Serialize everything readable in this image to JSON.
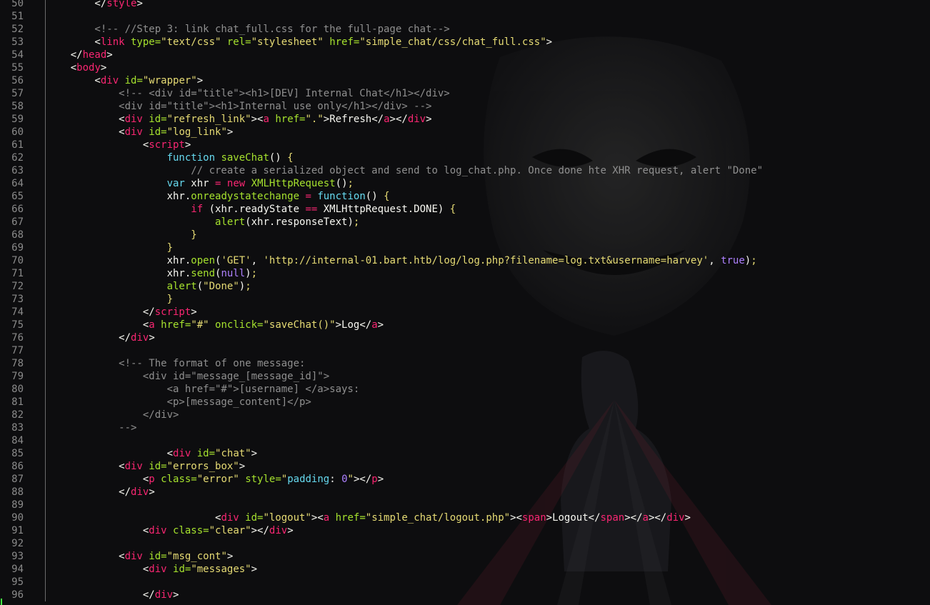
{
  "editor": {
    "lines": [
      {
        "n": "50",
        "tokens": [
          {
            "t": "        </",
            "c": "w"
          },
          {
            "t": "style",
            "c": "r"
          },
          {
            "t": ">",
            "c": "w"
          }
        ]
      },
      {
        "n": "51",
        "tokens": []
      },
      {
        "n": "52",
        "tokens": [
          {
            "t": "        <!-- //Step 3: link chat_full.css for the full-page chat-->",
            "c": "c"
          }
        ]
      },
      {
        "n": "53",
        "tokens": [
          {
            "t": "        <",
            "c": "w"
          },
          {
            "t": "link",
            "c": "r"
          },
          {
            "t": " type=",
            "c": "g"
          },
          {
            "t": "\"text/css\"",
            "c": "y"
          },
          {
            "t": " rel=",
            "c": "g"
          },
          {
            "t": "\"stylesheet\"",
            "c": "y"
          },
          {
            "t": " href=",
            "c": "g"
          },
          {
            "t": "\"simple_chat/css/chat_full.css\"",
            "c": "y"
          },
          {
            "t": ">",
            "c": "w"
          }
        ]
      },
      {
        "n": "54",
        "tokens": [
          {
            "t": "    </",
            "c": "w"
          },
          {
            "t": "head",
            "c": "r"
          },
          {
            "t": ">",
            "c": "w"
          }
        ]
      },
      {
        "n": "55",
        "tokens": [
          {
            "t": "    <",
            "c": "w"
          },
          {
            "t": "body",
            "c": "r"
          },
          {
            "t": ">",
            "c": "w"
          }
        ]
      },
      {
        "n": "56",
        "tokens": [
          {
            "t": "        <",
            "c": "w"
          },
          {
            "t": "div",
            "c": "r"
          },
          {
            "t": " id=",
            "c": "g"
          },
          {
            "t": "\"wrapper\"",
            "c": "y"
          },
          {
            "t": ">",
            "c": "w"
          }
        ]
      },
      {
        "n": "57",
        "tokens": [
          {
            "t": "            <!-- <div id=\"title\"><h1>[DEV] Internal Chat</h1></div>",
            "c": "c"
          }
        ]
      },
      {
        "n": "58",
        "tokens": [
          {
            "t": "            <div id=\"title\"><h1>Internal use only</h1></div> -->",
            "c": "c"
          }
        ]
      },
      {
        "n": "59",
        "tokens": [
          {
            "t": "            <",
            "c": "w"
          },
          {
            "t": "div",
            "c": "r"
          },
          {
            "t": " id=",
            "c": "g"
          },
          {
            "t": "\"refresh_link\"",
            "c": "y"
          },
          {
            "t": "><",
            "c": "w"
          },
          {
            "t": "a",
            "c": "r"
          },
          {
            "t": " href=",
            "c": "g"
          },
          {
            "t": "\".\"",
            "c": "y"
          },
          {
            "t": ">Refresh</",
            "c": "w"
          },
          {
            "t": "a",
            "c": "r"
          },
          {
            "t": "></",
            "c": "w"
          },
          {
            "t": "div",
            "c": "r"
          },
          {
            "t": ">",
            "c": "w"
          }
        ]
      },
      {
        "n": "60",
        "tokens": [
          {
            "t": "            <",
            "c": "w"
          },
          {
            "t": "div",
            "c": "r"
          },
          {
            "t": " id=",
            "c": "g"
          },
          {
            "t": "\"log_link\"",
            "c": "y"
          },
          {
            "t": ">",
            "c": "w"
          }
        ]
      },
      {
        "n": "61",
        "tokens": [
          {
            "t": "                <",
            "c": "w"
          },
          {
            "t": "script",
            "c": "r"
          },
          {
            "t": ">",
            "c": "w"
          }
        ]
      },
      {
        "n": "62",
        "tokens": [
          {
            "t": "                    ",
            "c": "w"
          },
          {
            "t": "function",
            "c": "b"
          },
          {
            "t": " saveChat",
            "c": "g"
          },
          {
            "t": "() ",
            "c": "w"
          },
          {
            "t": "{",
            "c": "y"
          }
        ]
      },
      {
        "n": "63",
        "tokens": [
          {
            "t": "                        // create a serialized object and send to log_chat.php. Once done hte XHR request, alert \"Done\"",
            "c": "c"
          }
        ]
      },
      {
        "n": "64",
        "tokens": [
          {
            "t": "                    ",
            "c": "w"
          },
          {
            "t": "var",
            "c": "b"
          },
          {
            "t": " xhr ",
            "c": "w"
          },
          {
            "t": "=",
            "c": "r"
          },
          {
            "t": " ",
            "c": "w"
          },
          {
            "t": "new",
            "c": "r"
          },
          {
            "t": " ",
            "c": "w"
          },
          {
            "t": "XMLHttpRequest",
            "c": "g"
          },
          {
            "t": "()",
            "c": "w"
          },
          {
            "t": ";",
            "c": "y"
          }
        ]
      },
      {
        "n": "65",
        "tokens": [
          {
            "t": "                    xhr.",
            "c": "w"
          },
          {
            "t": "onreadystatechange",
            "c": "g"
          },
          {
            "t": " ",
            "c": "w"
          },
          {
            "t": "=",
            "c": "r"
          },
          {
            "t": " ",
            "c": "w"
          },
          {
            "t": "function",
            "c": "b"
          },
          {
            "t": "() ",
            "c": "w"
          },
          {
            "t": "{",
            "c": "y"
          }
        ]
      },
      {
        "n": "66",
        "tokens": [
          {
            "t": "                        ",
            "c": "w"
          },
          {
            "t": "if",
            "c": "r"
          },
          {
            "t": " (xhr.readyState ",
            "c": "w"
          },
          {
            "t": "==",
            "c": "r"
          },
          {
            "t": " XMLHttpRequest.DONE) ",
            "c": "w"
          },
          {
            "t": "{",
            "c": "y"
          }
        ]
      },
      {
        "n": "67",
        "tokens": [
          {
            "t": "                            ",
            "c": "w"
          },
          {
            "t": "alert",
            "c": "g"
          },
          {
            "t": "(xhr.responseText)",
            "c": "w"
          },
          {
            "t": ";",
            "c": "y"
          }
        ]
      },
      {
        "n": "68",
        "tokens": [
          {
            "t": "                        ",
            "c": "w"
          },
          {
            "t": "}",
            "c": "y"
          }
        ]
      },
      {
        "n": "69",
        "tokens": [
          {
            "t": "                    ",
            "c": "w"
          },
          {
            "t": "}",
            "c": "y"
          }
        ]
      },
      {
        "n": "70",
        "tokens": [
          {
            "t": "                    xhr.",
            "c": "w"
          },
          {
            "t": "open",
            "c": "g"
          },
          {
            "t": "(",
            "c": "w"
          },
          {
            "t": "'GET'",
            "c": "y"
          },
          {
            "t": ", ",
            "c": "w"
          },
          {
            "t": "'http://internal-01.bart.htb/log/log.php?filename=log.txt&username=harvey'",
            "c": "y"
          },
          {
            "t": ", ",
            "c": "w"
          },
          {
            "t": "true",
            "c": "p"
          },
          {
            "t": ")",
            "c": "w"
          },
          {
            "t": ";",
            "c": "y"
          }
        ]
      },
      {
        "n": "71",
        "tokens": [
          {
            "t": "                    xhr.",
            "c": "w"
          },
          {
            "t": "send",
            "c": "g"
          },
          {
            "t": "(",
            "c": "w"
          },
          {
            "t": "null",
            "c": "p"
          },
          {
            "t": ")",
            "c": "w"
          },
          {
            "t": ";",
            "c": "y"
          }
        ]
      },
      {
        "n": "72",
        "tokens": [
          {
            "t": "                    ",
            "c": "w"
          },
          {
            "t": "alert",
            "c": "g"
          },
          {
            "t": "(",
            "c": "w"
          },
          {
            "t": "\"Done\"",
            "c": "y"
          },
          {
            "t": ")",
            "c": "w"
          },
          {
            "t": ";",
            "c": "y"
          }
        ]
      },
      {
        "n": "73",
        "tokens": [
          {
            "t": "                    ",
            "c": "w"
          },
          {
            "t": "}",
            "c": "y"
          }
        ]
      },
      {
        "n": "74",
        "tokens": [
          {
            "t": "                </",
            "c": "w"
          },
          {
            "t": "script",
            "c": "r"
          },
          {
            "t": ">",
            "c": "w"
          }
        ]
      },
      {
        "n": "75",
        "tokens": [
          {
            "t": "                <",
            "c": "w"
          },
          {
            "t": "a",
            "c": "r"
          },
          {
            "t": " href=",
            "c": "g"
          },
          {
            "t": "\"#\"",
            "c": "y"
          },
          {
            "t": " onclick=",
            "c": "g"
          },
          {
            "t": "\"saveChat()\"",
            "c": "y"
          },
          {
            "t": ">Log</",
            "c": "w"
          },
          {
            "t": "a",
            "c": "r"
          },
          {
            "t": ">",
            "c": "w"
          }
        ]
      },
      {
        "n": "76",
        "tokens": [
          {
            "t": "            </",
            "c": "w"
          },
          {
            "t": "div",
            "c": "r"
          },
          {
            "t": ">",
            "c": "w"
          }
        ]
      },
      {
        "n": "77",
        "tokens": []
      },
      {
        "n": "78",
        "tokens": [
          {
            "t": "            <!-- The format of one message:",
            "c": "c"
          }
        ]
      },
      {
        "n": "79",
        "tokens": [
          {
            "t": "                <div id=\"message_[message_id]\">",
            "c": "c"
          }
        ]
      },
      {
        "n": "80",
        "tokens": [
          {
            "t": "                    <a href=\"#\">[username] </a>says:",
            "c": "c"
          }
        ]
      },
      {
        "n": "81",
        "tokens": [
          {
            "t": "                    <p>[message_content]</p>",
            "c": "c"
          }
        ]
      },
      {
        "n": "82",
        "tokens": [
          {
            "t": "                </div>",
            "c": "c"
          }
        ]
      },
      {
        "n": "83",
        "tokens": [
          {
            "t": "            -->",
            "c": "c"
          }
        ]
      },
      {
        "n": "84",
        "tokens": []
      },
      {
        "n": "85",
        "tokens": [
          {
            "t": "                    <",
            "c": "w"
          },
          {
            "t": "div",
            "c": "r"
          },
          {
            "t": " id=",
            "c": "g"
          },
          {
            "t": "\"chat\"",
            "c": "y"
          },
          {
            "t": ">",
            "c": "w"
          }
        ]
      },
      {
        "n": "86",
        "tokens": [
          {
            "t": "            <",
            "c": "w"
          },
          {
            "t": "div",
            "c": "r"
          },
          {
            "t": " id=",
            "c": "g"
          },
          {
            "t": "\"errors_box\"",
            "c": "y"
          },
          {
            "t": ">",
            "c": "w"
          }
        ]
      },
      {
        "n": "87",
        "tokens": [
          {
            "t": "                <",
            "c": "w"
          },
          {
            "t": "p",
            "c": "r"
          },
          {
            "t": " class=",
            "c": "g"
          },
          {
            "t": "\"error\"",
            "c": "y"
          },
          {
            "t": " style=",
            "c": "g"
          },
          {
            "t": "\"",
            "c": "y"
          },
          {
            "t": "padding",
            "c": "b"
          },
          {
            "t": ": ",
            "c": "w"
          },
          {
            "t": "0",
            "c": "p"
          },
          {
            "t": "\"",
            "c": "y"
          },
          {
            "t": "></",
            "c": "w"
          },
          {
            "t": "p",
            "c": "r"
          },
          {
            "t": ">",
            "c": "w"
          }
        ]
      },
      {
        "n": "88",
        "tokens": [
          {
            "t": "            </",
            "c": "w"
          },
          {
            "t": "div",
            "c": "r"
          },
          {
            "t": ">",
            "c": "w"
          }
        ]
      },
      {
        "n": "89",
        "tokens": []
      },
      {
        "n": "90",
        "tokens": [
          {
            "t": "                            <",
            "c": "w"
          },
          {
            "t": "div",
            "c": "r"
          },
          {
            "t": " id=",
            "c": "g"
          },
          {
            "t": "\"logout\"",
            "c": "y"
          },
          {
            "t": "><",
            "c": "w"
          },
          {
            "t": "a",
            "c": "r"
          },
          {
            "t": " href=",
            "c": "g"
          },
          {
            "t": "\"simple_chat/logout.php\"",
            "c": "y"
          },
          {
            "t": "><",
            "c": "w"
          },
          {
            "t": "span",
            "c": "r"
          },
          {
            "t": ">Logout</",
            "c": "w"
          },
          {
            "t": "span",
            "c": "r"
          },
          {
            "t": "></",
            "c": "w"
          },
          {
            "t": "a",
            "c": "r"
          },
          {
            "t": "></",
            "c": "w"
          },
          {
            "t": "div",
            "c": "r"
          },
          {
            "t": ">",
            "c": "w"
          }
        ]
      },
      {
        "n": "91",
        "tokens": [
          {
            "t": "                <",
            "c": "w"
          },
          {
            "t": "div",
            "c": "r"
          },
          {
            "t": " class=",
            "c": "g"
          },
          {
            "t": "\"clear\"",
            "c": "y"
          },
          {
            "t": "></",
            "c": "w"
          },
          {
            "t": "div",
            "c": "r"
          },
          {
            "t": ">",
            "c": "w"
          }
        ]
      },
      {
        "n": "92",
        "tokens": []
      },
      {
        "n": "93",
        "tokens": [
          {
            "t": "            <",
            "c": "w"
          },
          {
            "t": "div",
            "c": "r"
          },
          {
            "t": " id=",
            "c": "g"
          },
          {
            "t": "\"msg_cont\"",
            "c": "y"
          },
          {
            "t": ">",
            "c": "w"
          }
        ]
      },
      {
        "n": "94",
        "tokens": [
          {
            "t": "                <",
            "c": "w"
          },
          {
            "t": "div",
            "c": "r"
          },
          {
            "t": " id=",
            "c": "g"
          },
          {
            "t": "\"messages\"",
            "c": "y"
          },
          {
            "t": ">",
            "c": "w"
          }
        ]
      },
      {
        "n": "95",
        "tokens": []
      },
      {
        "n": "96",
        "tokens": [
          {
            "t": "                </",
            "c": "w"
          },
          {
            "t": "div",
            "c": "r"
          },
          {
            "t": ">",
            "c": "w"
          }
        ]
      }
    ]
  },
  "colors": {
    "background": "#0d0d0f",
    "line_number": "#8a8a8a",
    "text": "#f8f8f2",
    "keyword_pink": "#f92672",
    "attribute_green": "#a6e22e",
    "string_yellow": "#e6db74",
    "comment_gray": "#8f8f8f",
    "storage_cyan": "#66d9ef",
    "constant_purple": "#ae81ff",
    "cursor_green": "#44ff44"
  }
}
